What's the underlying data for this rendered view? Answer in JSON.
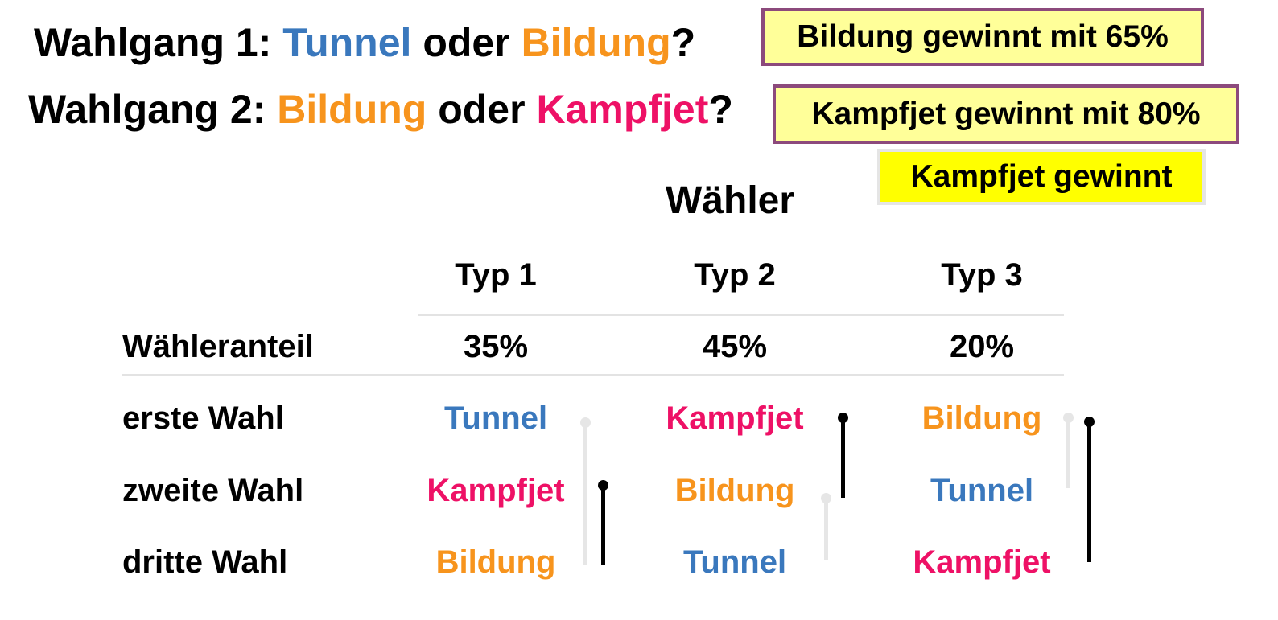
{
  "round1": {
    "prefix": "Wahlgang 1: ",
    "option_a": "Tunnel",
    "connector": " oder ",
    "option_b": "Bildung",
    "suffix": "?",
    "result": "Bildung gewinnt mit 65%"
  },
  "round2": {
    "prefix": "Wahlgang 2: ",
    "option_a": "Bildung",
    "connector": " oder ",
    "option_b": "Kampfjet",
    "suffix": "?",
    "result": "Kampfjet gewinnt mit 80%"
  },
  "overall_result": "Kampfjet gewinnt",
  "table": {
    "heading": "Wähler",
    "columns": [
      "Typ 1",
      "Typ 2",
      "Typ 3"
    ],
    "row_labels": {
      "share": "Wähleranteil",
      "first": "erste Wahl",
      "second": "zweite Wahl",
      "third": "dritte Wahl"
    },
    "shares": [
      "35%",
      "45%",
      "20%"
    ],
    "preferences": [
      [
        "Tunnel",
        "Kampfjet",
        "Bildung"
      ],
      [
        "Kampfjet",
        "Bildung",
        "Tunnel"
      ],
      [
        "Bildung",
        "Tunnel",
        "Kampfjet"
      ]
    ]
  },
  "colors": {
    "Tunnel": "#3a78bd",
    "Bildung": "#f7941d",
    "Kampfjet": "#ee1166",
    "result_box_fill": "#ffff99",
    "result_box_border": "#8c4a7c",
    "overall_box_fill": "#ffff00"
  }
}
